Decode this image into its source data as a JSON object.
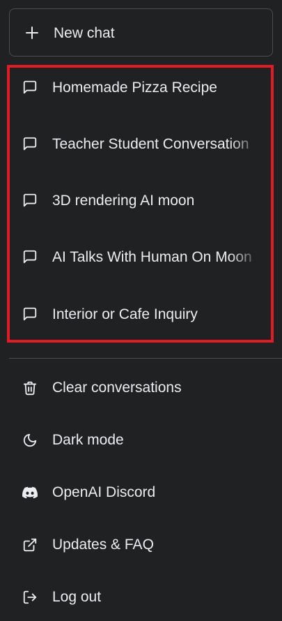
{
  "new_chat": {
    "label": "New chat",
    "icon": "plus-icon"
  },
  "conversations": [
    {
      "title": "Homemade Pizza Recipe",
      "icon": "chat-bubble-icon"
    },
    {
      "title": "Teacher Student Conversation",
      "icon": "chat-bubble-icon"
    },
    {
      "title": "3D rendering AI moon",
      "icon": "chat-bubble-icon"
    },
    {
      "title": "AI Talks With Human On Moon",
      "icon": "chat-bubble-icon"
    },
    {
      "title": "Interior or Cafe Inquiry",
      "icon": "chat-bubble-icon"
    }
  ],
  "highlight_color": "#e01b24",
  "menu": [
    {
      "label": "Clear conversations",
      "icon": "trash-icon"
    },
    {
      "label": "Dark mode",
      "icon": "moon-icon"
    },
    {
      "label": "OpenAI Discord",
      "icon": "discord-icon"
    },
    {
      "label": "Updates & FAQ",
      "icon": "external-link-icon"
    },
    {
      "label": "Log out",
      "icon": "logout-icon"
    }
  ],
  "colors": {
    "background": "#202123",
    "text": "#ececf1",
    "border": "#4d4d4f"
  }
}
